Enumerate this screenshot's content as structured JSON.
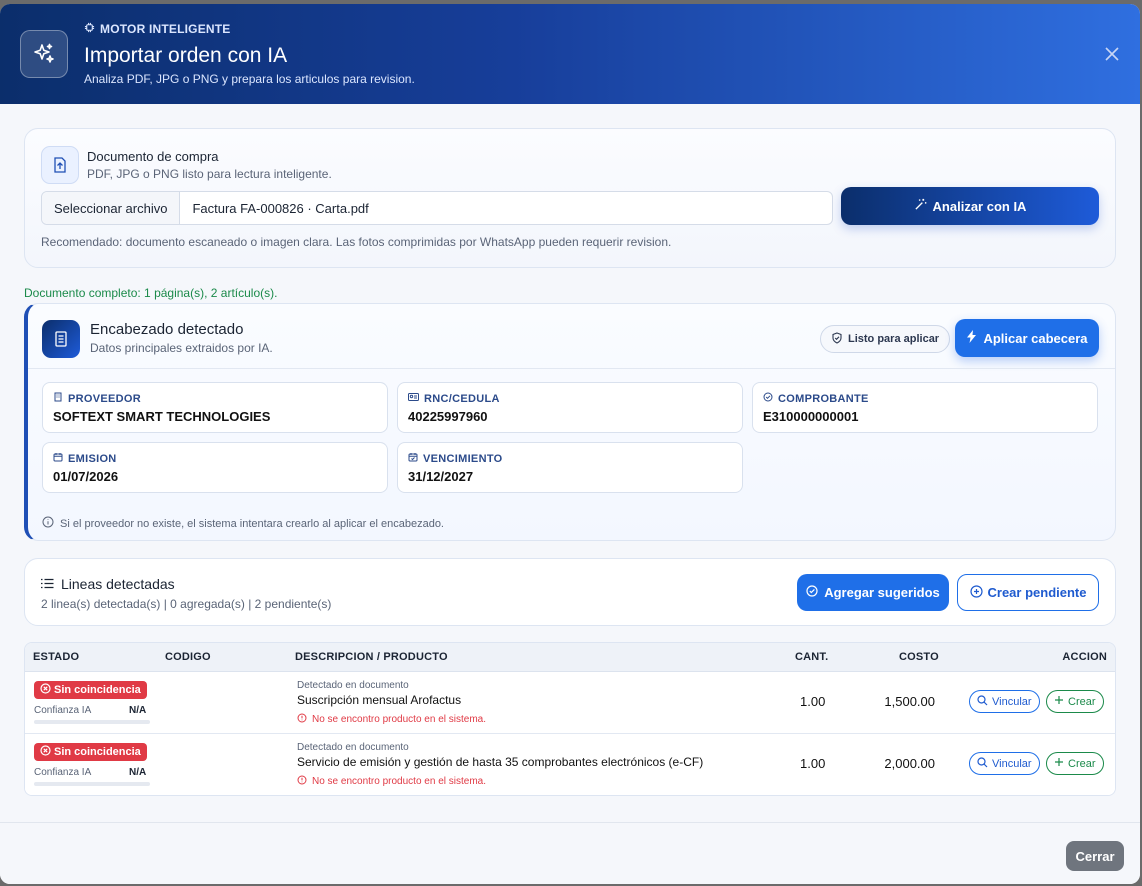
{
  "header": {
    "eyebrow": "MOTOR INTELIGENTE",
    "title": "Importar orden con IA",
    "subtitle": "Analiza PDF, JPG o PNG y prepara los articulos para revision."
  },
  "document": {
    "title": "Documento de compra",
    "subtitle": "PDF, JPG o PNG listo para lectura inteligente.",
    "file_button": "Seleccionar archivo",
    "file_name": "Factura FA-000826 · Carta.pdf",
    "analyze_label": "Analizar con IA",
    "note": "Recomendado: documento escaneado o imagen clara. Las fotos comprimidas por WhatsApp pueden requerir revision."
  },
  "status_message": "Documento completo: 1 página(s), 2 artículo(s).",
  "detected_header": {
    "title": "Encabezado detectado",
    "subtitle": "Datos principales extraidos por IA.",
    "ready_badge": "Listo para aplicar",
    "apply_label": "Aplicar cabecera",
    "fields": [
      {
        "label": "PROVEEDOR",
        "value": "SOFTEXT SMART TECHNOLOGIES",
        "icon": "building-icon"
      },
      {
        "label": "RNC/CEDULA",
        "value": "40225997960",
        "icon": "id-card-icon"
      },
      {
        "label": "COMPROBANTE",
        "value": "E310000000001",
        "icon": "check-circle-icon"
      },
      {
        "label": "EMISION",
        "value": "01/07/2026",
        "icon": "calendar-icon"
      },
      {
        "label": "VENCIMIENTO",
        "value": "31/12/2027",
        "icon": "calendar-check-icon"
      }
    ],
    "note": "Si el proveedor no existe, el sistema intentara crearlo al aplicar el encabezado."
  },
  "lines": {
    "title": "Lineas detectadas",
    "summary": "2 linea(s) detectada(s) | 0 agregada(s) | 2 pendiente(s)",
    "add_suggested_label": "Agregar sugeridos",
    "create_pending_label": "Crear pendiente"
  },
  "table": {
    "columns": {
      "estado": "ESTADO",
      "codigo": "CODIGO",
      "descripcion": "DESCRIPCION / PRODUCTO",
      "cant": "CANT.",
      "costo": "COSTO",
      "accion": "ACCION"
    },
    "rows": [
      {
        "status": "Sin coincidencia",
        "confidence_label": "Confianza IA",
        "confidence_value": "N/A",
        "code": "",
        "detected_label": "Detectado en documento",
        "description": "Suscripción mensual Arofactus",
        "error": "No se encontro producto en el sistema.",
        "qty": "1.00",
        "cost": "1,500.00",
        "link_label": "Vincular",
        "create_label": "Crear"
      },
      {
        "status": "Sin coincidencia",
        "confidence_label": "Confianza IA",
        "confidence_value": "N/A",
        "code": "",
        "detected_label": "Detectado en documento",
        "description": "Servicio de emisión y gestión de hasta 35 comprobantes electrónicos (e-CF)",
        "error": "No se encontro producto en el sistema.",
        "qty": "1.00",
        "cost": "2,000.00",
        "link_label": "Vincular",
        "create_label": "Crear"
      }
    ]
  },
  "footer": {
    "close_label": "Cerrar"
  },
  "colors": {
    "brand_dark": "#0b2e6b",
    "brand": "#1f6fe8",
    "success": "#1b8a4a",
    "danger": "#e03a45"
  }
}
